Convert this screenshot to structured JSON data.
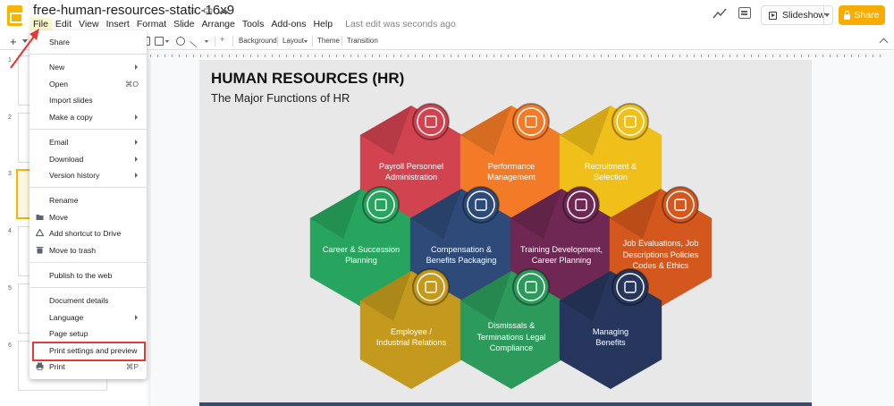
{
  "doc": {
    "title": "free-human-resources-static-16x9",
    "last_edit": "Last edit was seconds ago"
  },
  "menubar": [
    "File",
    "Edit",
    "View",
    "Insert",
    "Format",
    "Slide",
    "Arrange",
    "Tools",
    "Add-ons",
    "Help"
  ],
  "header": {
    "slideshow_label": "Slideshow",
    "share_label": "Share"
  },
  "toolbar": {
    "add_slide_label": "+",
    "background_label": "Background",
    "layout_label": "Layout",
    "theme_label": "Theme",
    "transition_label": "Transition"
  },
  "filmstrip": {
    "slide_numbers": [
      "1",
      "2",
      "3",
      "4",
      "5",
      "6"
    ]
  },
  "file_menu": {
    "share": "Share",
    "new": "New",
    "open": "Open",
    "open_shortcut": "⌘O",
    "import_slides": "Import slides",
    "make_copy": "Make a copy",
    "email": "Email",
    "download": "Download",
    "version_history": "Version history",
    "rename": "Rename",
    "move": "Move",
    "add_shortcut": "Add shortcut to Drive",
    "move_to_trash": "Move to trash",
    "publish": "Publish to the web",
    "document_details": "Document details",
    "language": "Language",
    "page_setup": "Page setup",
    "print_settings": "Print settings and preview",
    "print": "Print",
    "print_shortcut": "⌘P"
  },
  "slide": {
    "title": "HUMAN RESOURCES (HR)",
    "subtitle": "The Major Functions of HR",
    "functions": [
      {
        "l1": "Payroll Personnel",
        "l2": "Administration",
        "l3": "",
        "color": "#d0434f",
        "icon": "payroll-icon"
      },
      {
        "l1": "Performance",
        "l2": "Management",
        "l3": "",
        "color": "#f37b27",
        "icon": "performance-icon"
      },
      {
        "l1": "Recruitment &",
        "l2": "Selection",
        "l3": "",
        "color": "#f0bf1a",
        "icon": "recruitment-icon"
      },
      {
        "l1": "Career & Succession",
        "l2": "Planning",
        "l3": "",
        "color": "#27a45d",
        "icon": "career-icon"
      },
      {
        "l1": "Compensation &",
        "l2": "Benefits Packaging",
        "l3": "",
        "color": "#2e4a78",
        "icon": "compensation-icon"
      },
      {
        "l1": "Training Development,",
        "l2": "Career Planning",
        "l3": "",
        "color": "#6f2853",
        "icon": "training-icon"
      },
      {
        "l1": "Job Evaluations, Job",
        "l2": "Descriptions Policies",
        "l3": "Codes & Ethics",
        "color": "#d4571d",
        "icon": "evaluation-icon"
      },
      {
        "l1": "Employee /",
        "l2": "Industrial Relations",
        "l3": "",
        "color": "#c49a1e",
        "icon": "relations-icon"
      },
      {
        "l1": "Dismissals &",
        "l2": "Terminations Legal",
        "l3": "Compliance",
        "color": "#2c9a5a",
        "icon": "gavel-icon"
      },
      {
        "l1": "Managing",
        "l2": "Benefits",
        "l3": "",
        "color": "#27365c",
        "icon": "benefits-icon"
      }
    ]
  },
  "colors": {
    "accent_yellow": "#f9ab00",
    "highlight_red": "#e53935"
  }
}
